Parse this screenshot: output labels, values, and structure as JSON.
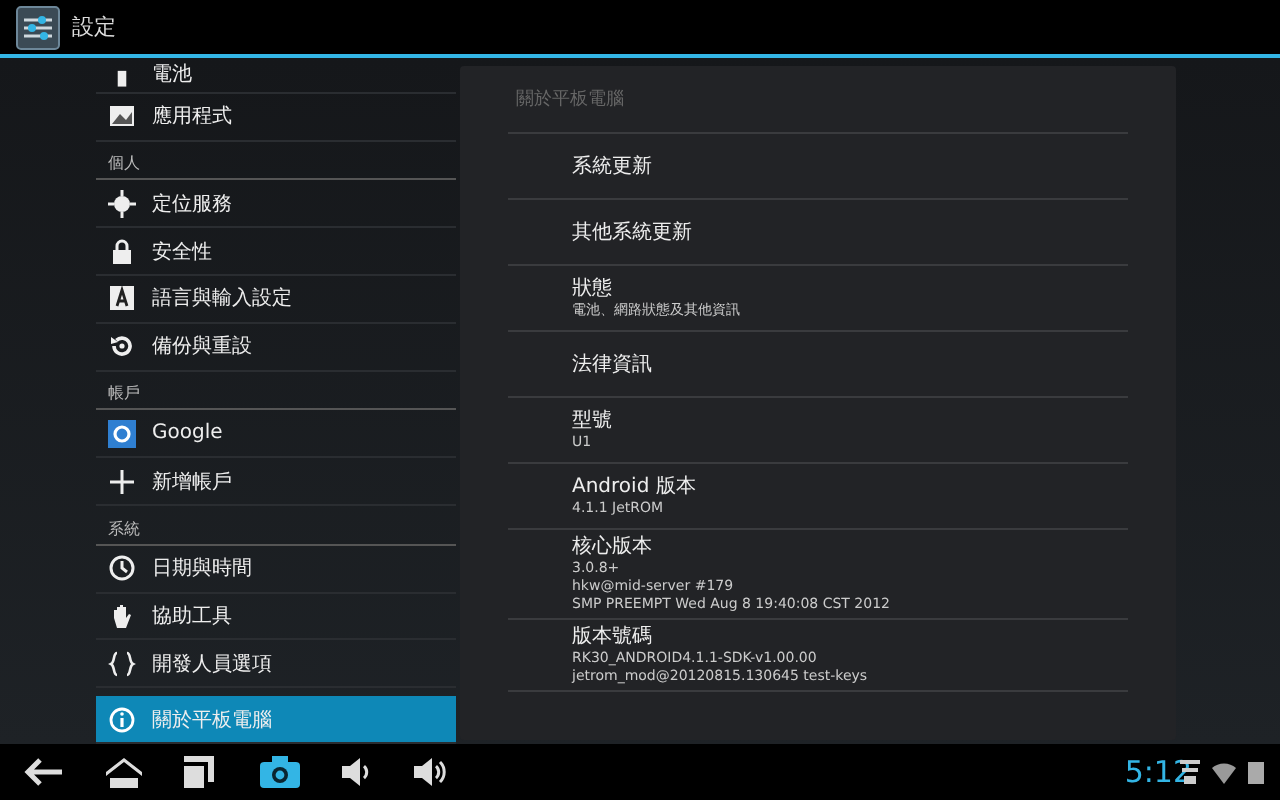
{
  "action_bar": {
    "title": "設定"
  },
  "sidebar": {
    "items": [
      {
        "kind": "item",
        "label": "電池",
        "selected": false
      },
      {
        "kind": "item",
        "label": "應用程式",
        "selected": false
      },
      {
        "kind": "header",
        "label": "個人"
      },
      {
        "kind": "item",
        "label": "定位服務",
        "selected": false
      },
      {
        "kind": "item",
        "label": "安全性",
        "selected": false
      },
      {
        "kind": "item",
        "label": "語言與輸入設定",
        "selected": false
      },
      {
        "kind": "item",
        "label": "備份與重設",
        "selected": false
      },
      {
        "kind": "header",
        "label": "帳戶"
      },
      {
        "kind": "item",
        "label": "Google",
        "selected": false
      },
      {
        "kind": "item",
        "label": "新增帳戶",
        "selected": false
      },
      {
        "kind": "header",
        "label": "系統"
      },
      {
        "kind": "item",
        "label": "日期與時間",
        "selected": false
      },
      {
        "kind": "item",
        "label": "協助工具",
        "selected": false
      },
      {
        "kind": "item",
        "label": "開發人員選項",
        "selected": false
      },
      {
        "kind": "item",
        "label": "關於平板電腦",
        "selected": true
      }
    ]
  },
  "detail": {
    "title": "關於平板電腦",
    "items": [
      {
        "title": "系統更新"
      },
      {
        "title": "其他系統更新"
      },
      {
        "title": "狀態",
        "lines": [
          "電池、網路狀態及其他資訊"
        ]
      },
      {
        "title": "法律資訊"
      },
      {
        "title": "型號",
        "lines": [
          "U1"
        ]
      },
      {
        "title": "Android 版本",
        "lines": [
          "4.1.1 JetROM"
        ]
      },
      {
        "title": "核心版本",
        "lines": [
          "3.0.8+",
          "hkw@mid-server #179",
          "SMP PREEMPT Wed Aug 8 19:40:08 CST 2012"
        ]
      },
      {
        "title": "版本號碼",
        "lines": [
          "RK30_ANDROID4.1.1-SDK-v1.00.00",
          "jetrom_mod@20120815.130645 test-keys"
        ]
      }
    ]
  },
  "status_bar": {
    "time": "5:12"
  }
}
